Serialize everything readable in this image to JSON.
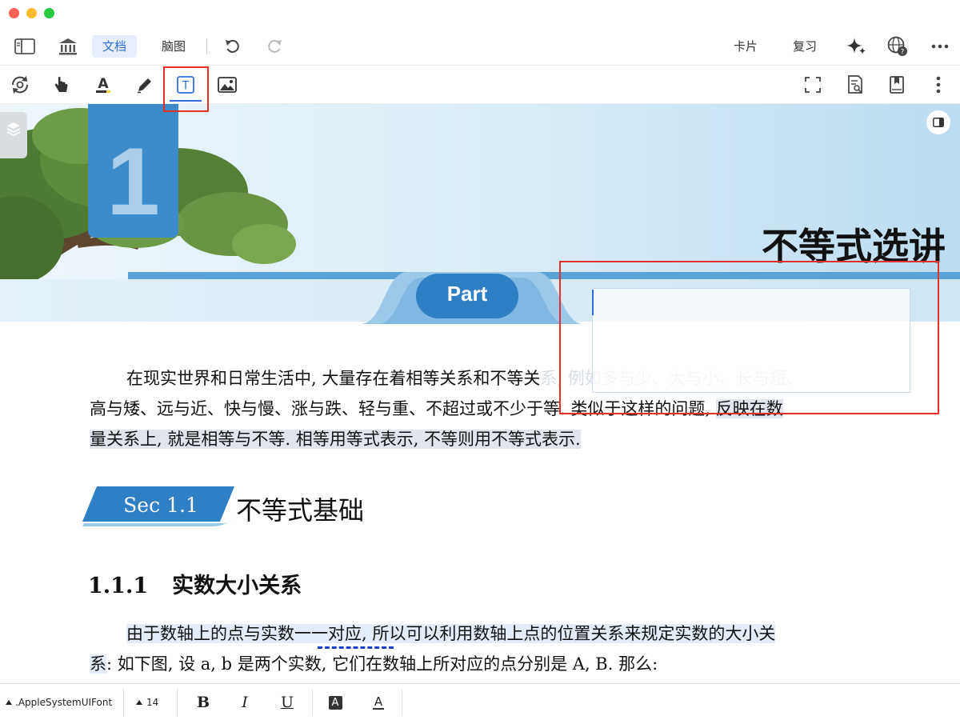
{
  "toolbar": {
    "tabs": [
      {
        "label": "文档",
        "active": true
      },
      {
        "label": "脑图",
        "active": false
      }
    ],
    "right_labels": {
      "cards": "卡片",
      "review": "复习"
    }
  },
  "document": {
    "banner": {
      "chapter_number": "1",
      "title": "不等式选讲",
      "part_label": "Part"
    },
    "paragraph1": {
      "line1_a": "在现实世界和日常生活中, 大量存在着相等关系和不等关",
      "line1_b": "系, 例如多与少、大与小、长与短、",
      "line2_a": "高与矮、远与近、快与慢、涨与跌、轻与重、不超过或不少于等. 类似于这样的问题, ",
      "line2_b": "反映在数",
      "line3": "量关系上, 就是相等与不等. 相等用等式表示, 不等则用不等式表示."
    },
    "section": {
      "badge": "Sec 1.1",
      "title": "不等式基础"
    },
    "subsection": {
      "number": "1.1.1",
      "title": "实数大小关系"
    },
    "paragraph2": {
      "line1_a": "由于数轴上的点与实数",
      "line1_b": "一一对应",
      "line1_c": ", 所以可以利用数轴上点的位置关系来规定实数的大小关",
      "line2_a": "系",
      "line2_b": ": 如下图, 设 a, b 是两个实数, 它们在数轴上所对应的点分别是 A, B. 那么:"
    }
  },
  "format_bar": {
    "font_name": ".AppleSystemUIFont",
    "font_size": "14",
    "bold": "B",
    "italic": "I",
    "underline": "U",
    "highlight": "A",
    "text_color": "A"
  },
  "colors": {
    "accent": "#2f6fe0",
    "annotation_red": "#e4302b",
    "banner_blue": "#3c8ccc"
  }
}
